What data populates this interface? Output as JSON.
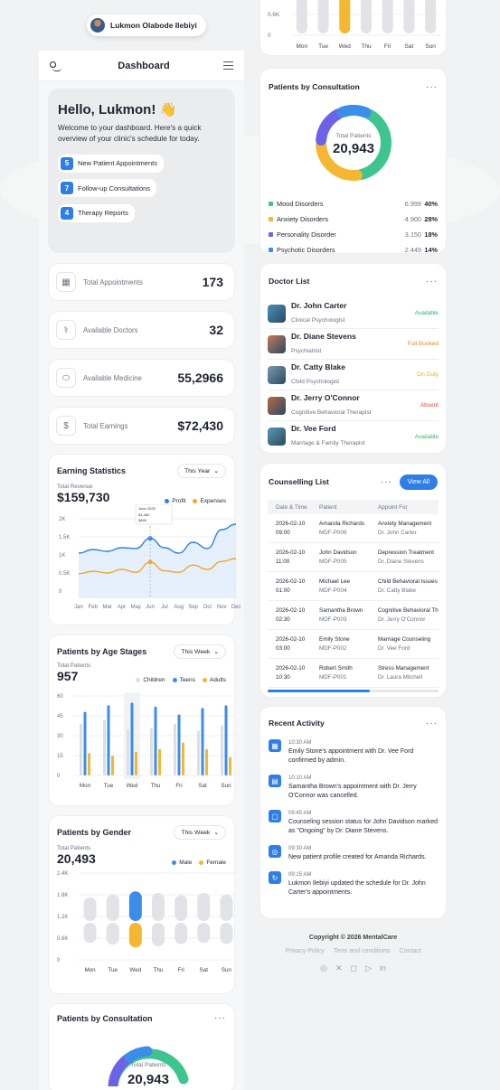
{
  "user": {
    "name": "Lukmon Olabode Ilebiyi"
  },
  "header": {
    "title": "Dashboard"
  },
  "greeting": {
    "title": "Hello, Lukmon! 👋",
    "text": "Welcome to your dashboard. Here's a quick overview of your clinic's schedule for today.",
    "items": [
      {
        "n": "5",
        "label": "New Patient Appointments"
      },
      {
        "n": "7",
        "label": "Follow-up Consultations"
      },
      {
        "n": "4",
        "label": "Therapy Reports"
      }
    ]
  },
  "stats": [
    {
      "icon": "calendar-icon",
      "label": "Total Appointments",
      "value": "173"
    },
    {
      "icon": "stethoscope-icon",
      "label": "Available Doctors",
      "value": "32"
    },
    {
      "icon": "pill-icon",
      "label": "Available Medicine",
      "value": "55,2966"
    },
    {
      "icon": "dollar-icon",
      "label": "Total Earnings",
      "value": "$72,430"
    }
  ],
  "earning": {
    "title": "Earning Statistics",
    "period": "This Year",
    "total_label": "Total Revenue",
    "total": "$159,730",
    "chart_data": {
      "type": "line",
      "categories": [
        "Jan",
        "Feb",
        "Mar",
        "Apr",
        "May",
        "Jun",
        "Jul",
        "Aug",
        "Sep",
        "Oct",
        "Nov",
        "Dec"
      ],
      "yticks": [
        "2K",
        "1.5K",
        "1K",
        "0.5K",
        "0"
      ],
      "ylim": [
        0,
        2000
      ],
      "series": [
        {
          "name": "Profit",
          "color": "#2f7ee8",
          "values": [
            1050,
            1150,
            1100,
            1200,
            1180,
            1460,
            1200,
            1050,
            1350,
            1180,
            1700,
            1850
          ]
        },
        {
          "name": "Expenses",
          "color": "#f5a623",
          "values": [
            480,
            550,
            500,
            600,
            520,
            800,
            560,
            520,
            720,
            600,
            820,
            900
          ]
        }
      ],
      "tooltip": {
        "date": "June 2025",
        "profit": "$1,460",
        "expenses": "$480"
      }
    }
  },
  "age": {
    "title": "Patients by Age Stages",
    "period": "This Week",
    "total_label": "Total Patients",
    "total": "957",
    "chart_data": {
      "type": "bar",
      "categories": [
        "Mon",
        "Tue",
        "Wed",
        "Thu",
        "Fri",
        "Sat",
        "Sun"
      ],
      "yticks": [
        "60",
        "45",
        "30",
        "15",
        "0"
      ],
      "ylim": [
        0,
        60
      ],
      "series": [
        {
          "name": "Children",
          "color": "#dcdee3",
          "values": [
            39,
            42,
            35,
            36,
            39,
            34,
            38
          ]
        },
        {
          "name": "Teens",
          "color": "#3b8de8",
          "values": [
            48,
            53,
            55,
            52,
            46,
            51,
            53
          ]
        },
        {
          "name": "Adults",
          "color": "#f5b731",
          "values": [
            17,
            15,
            18,
            20,
            25,
            20,
            14
          ]
        }
      ]
    }
  },
  "gender": {
    "title": "Patients by Gender",
    "period": "This Week",
    "total_label": "Total Patients",
    "total": "20,493",
    "chart_data": {
      "type": "bar",
      "categories": [
        "Mon",
        "Tue",
        "Wed",
        "Thu",
        "Fri",
        "Sat",
        "Sun"
      ],
      "yticks": [
        "2.4K",
        "1.8K",
        "1.2K",
        "0.6K",
        "0"
      ],
      "ylim": [
        0,
        2400
      ],
      "series": [
        {
          "name": "Male",
          "color": "#3b8de8",
          "values": [
            1050,
            1180,
            1320,
            1250,
            1150,
            1250,
            1180
          ]
        },
        {
          "name": "Female",
          "color": "#f5b731",
          "values": [
            900,
            980,
            1100,
            1050,
            950,
            900,
            950
          ]
        }
      ]
    }
  },
  "consult_bottom": {
    "title": "Patients by Consultation",
    "total_label": "Total Patients",
    "total": "20,943"
  },
  "week_chart": {
    "chart_data": {
      "type": "bar",
      "categories": [
        "Mon",
        "Tue",
        "Wed",
        "Thu",
        "Fri",
        "Sat",
        "Sun"
      ],
      "yticks": [
        "0.6K",
        "0"
      ]
    }
  },
  "consultation": {
    "title": "Patients by Consultation",
    "total_label": "Total Patients",
    "total": "20,943",
    "chart_data": {
      "type": "pie",
      "items": [
        {
          "name": "Mood Disorders",
          "value": "6.999",
          "pct": "40%",
          "color": "#3ec48f"
        },
        {
          "name": "Anxiety Disorders",
          "value": "4.900",
          "pct": "28%",
          "color": "#f5b731"
        },
        {
          "name": "Personality Disorder",
          "value": "3.150",
          "pct": "18%",
          "color": "#6c62e8"
        },
        {
          "name": "Psychotic Disorders",
          "value": "2.449",
          "pct": "14%",
          "color": "#3b8de8"
        }
      ]
    }
  },
  "doctors": {
    "title": "Doctor List",
    "items": [
      {
        "name": "Dr. John Carter",
        "role": "Clinical Psychologist",
        "status": "Available",
        "color": "#32b36b"
      },
      {
        "name": "Dr. Diane Stevens",
        "role": "Psychiatrist",
        "status": "Full Booked",
        "color": "#e8862a"
      },
      {
        "name": "Dr. Catty Blake",
        "role": "Child Psychologist",
        "status": "On Duty",
        "color": "#e0b21f"
      },
      {
        "name": "Dr. Jerry O'Connor",
        "role": "Cognitive Behavioral Therapist",
        "status": "Absent",
        "color": "#e0483c"
      },
      {
        "name": "Dr. Vee Ford",
        "role": "Marriage & Family Therapist",
        "status": "Available",
        "color": "#32b36b"
      }
    ]
  },
  "counselling": {
    "title": "Counselling List",
    "view_all": "View All",
    "cols": [
      "Date & Time",
      "Patient",
      "Appoint For"
    ],
    "rows": [
      {
        "date": "2026-02-10",
        "time": "09:00",
        "patient": "Amanda Richards",
        "id": "MDF-P006",
        "for": "Anxiety Management",
        "doc": "Dr. John Carter"
      },
      {
        "date": "2026-02-10",
        "time": "11:00",
        "patient": "John Davidson",
        "id": "MDF-P005",
        "for": "Depression Treatment",
        "doc": "Dr. Diane Stevens"
      },
      {
        "date": "2026-02-10",
        "time": "01:00",
        "patient": "Michael Lee",
        "id": "MDF-P004",
        "for": "Child Behavioral Issues",
        "doc": "Dr. Catty Blake"
      },
      {
        "date": "2026-02-10",
        "time": "02:30",
        "patient": "Samantha Brown",
        "id": "MDF-P003",
        "for": "Cognitive Behavioral Th",
        "doc": "Dr. Jerry O'Connor"
      },
      {
        "date": "2026-02-10",
        "time": "03:00",
        "patient": "Emily Stone",
        "id": "MDF-P002",
        "for": "Marriage Counseling",
        "doc": "Dr. Vee Ford"
      },
      {
        "date": "2026-02-10",
        "time": "10:30",
        "patient": "Robert Smith",
        "id": "MDF-P001",
        "for": "Stress Management",
        "doc": "Dr. Laura Mitchell"
      }
    ]
  },
  "activity": {
    "title": "Recent Activity",
    "items": [
      {
        "time": "10:30 AM",
        "text": "Emily Stone's appointment with Dr. Vee Ford confirmed by admin."
      },
      {
        "time": "10:10 AM",
        "text": "Samantha Brown's appointment with Dr. Jerry O'Connor was cancelled."
      },
      {
        "time": "09:45 AM",
        "text": "Counseling session status for John Davidson marked as \"Ongoing\" by Dr. Diane Stevens."
      },
      {
        "time": "09:30 AM",
        "text": "New patient profile created for Amanda Richards."
      },
      {
        "time": "09:15 AM",
        "text": "Lukmon Ilebiyi updated the schedule for Dr. John Carter's appointments."
      }
    ]
  },
  "footer": {
    "copyright": "Copyright © 2026 MentalCare",
    "links": [
      "Privacy Policy",
      "Term and conditions",
      "Contact"
    ]
  }
}
